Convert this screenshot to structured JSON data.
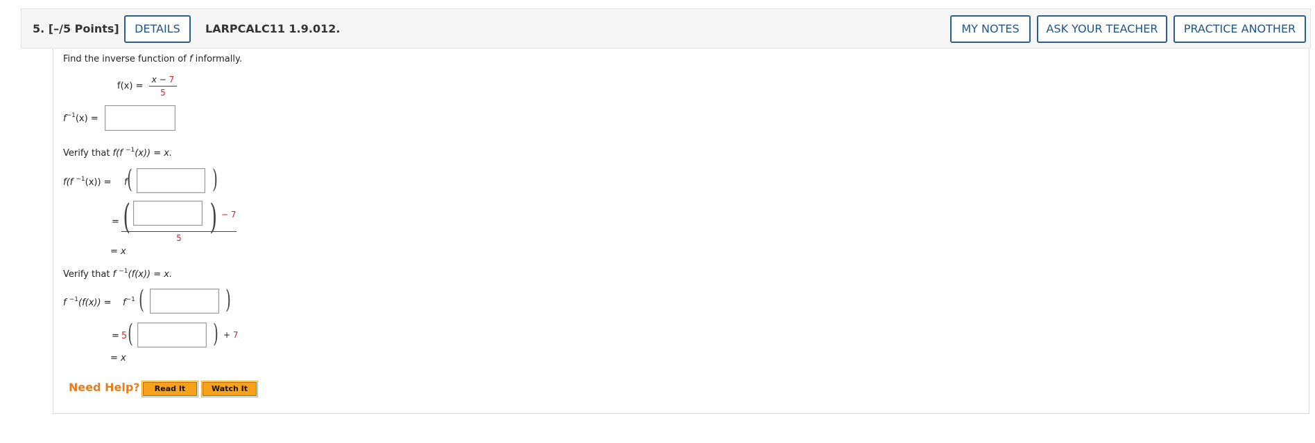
{
  "header": {
    "question_number": "5.",
    "points": "[–/5 Points]",
    "details_label": "DETAILS",
    "code": "LARPCALC11 1.9.012.",
    "my_notes_label": "MY NOTES",
    "ask_teacher_label": "ASK YOUR TEACHER",
    "practice_another_label": "PRACTICE ANOTHER"
  },
  "problem": {
    "prompt_start": "Find the inverse function of ",
    "prompt_var": "f",
    "prompt_end": " informally.",
    "f_def_lhs": "f(x) =",
    "f_def_num": "x − 7",
    "f_def_den": "5",
    "inverse_lhs_f": "f",
    "inverse_lhs_exp": "−1",
    "inverse_lhs_rest": "(x) ="
  },
  "verify1": {
    "title_start": "Verify that ",
    "title_expr_a": "f(f ",
    "title_exp": "−1",
    "title_expr_b": "(x)) = x.",
    "lhs_a": "f(f ",
    "lhs_exp": "−1",
    "lhs_b": "(x)) =",
    "lhs_f": "f",
    "eq_sign": "=",
    "minus_const": "− 7",
    "denominator": "5",
    "result": "= x"
  },
  "verify2": {
    "title_start": "Verify that ",
    "title_expr_a": "f ",
    "title_exp": "−1",
    "title_expr_b": "(f(x)) = x.",
    "lhs_a": "f ",
    "lhs_exp": "−1",
    "lhs_b": "(f(x)) =",
    "lhs_f": "f",
    "lhs_f_exp": "−1",
    "eq_sign": "=",
    "coef": "5",
    "plus_const": "+ 7",
    "result": "= x"
  },
  "help": {
    "label": "Need Help?",
    "read_it": "Read It",
    "watch_it": "Watch It"
  },
  "colors": {
    "accent": "#2a5d8f",
    "constant_red": "#d6242a",
    "help_orange": "#e87d1e",
    "button_orange": "#f7a21a"
  }
}
